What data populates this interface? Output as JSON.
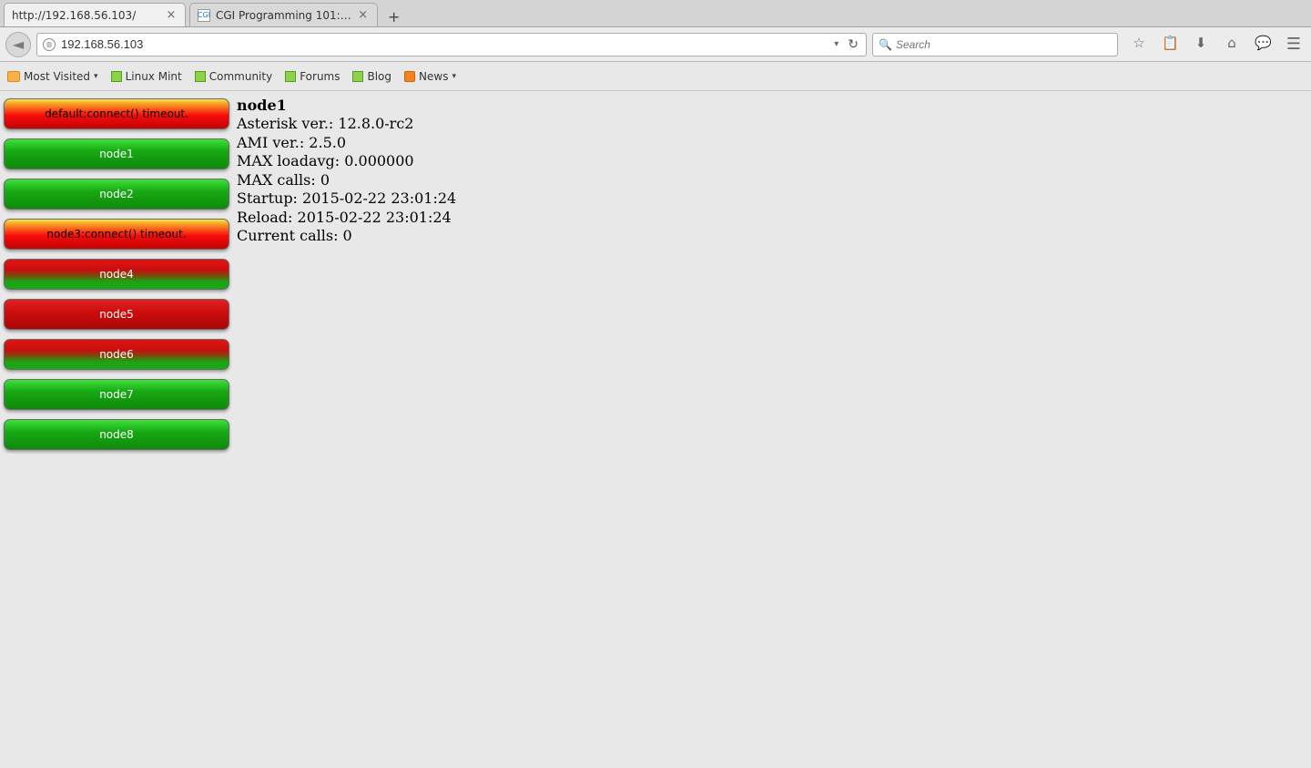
{
  "tabs": [
    {
      "title": "http://192.168.56.103/",
      "active": true
    },
    {
      "title": "CGI Programming 101:…",
      "active": false
    }
  ],
  "url_bar": {
    "value": "192.168.56.103"
  },
  "search": {
    "placeholder": "Search"
  },
  "bookmarks": {
    "most_visited": "Most Visited",
    "linux_mint": "Linux Mint",
    "community": "Community",
    "forums": "Forums",
    "blog": "Blog",
    "news": "News"
  },
  "nodes": [
    {
      "label": "default:connect() timeout.",
      "style": "error"
    },
    {
      "label": "node1",
      "style": "green"
    },
    {
      "label": "node2",
      "style": "green"
    },
    {
      "label": "node3:connect() timeout.",
      "style": "error"
    },
    {
      "label": "node4",
      "style": "redgreen"
    },
    {
      "label": "node5",
      "style": "red"
    },
    {
      "label": "node6",
      "style": "redgreen"
    },
    {
      "label": "node7",
      "style": "green"
    },
    {
      "label": "node8",
      "style": "green"
    }
  ],
  "detail": {
    "title": "node1",
    "asterisk": "Asterisk ver.: 12.8.0-rc2",
    "ami": "AMI ver.: 2.5.0",
    "max_loadavg": "MAX loadavg: 0.000000",
    "max_calls": "MAX calls: 0",
    "startup": "Startup: 2015-02-22 23:01:24",
    "reload": "Reload: 2015-02-22 23:01:24",
    "current_calls": "Current calls: 0"
  }
}
